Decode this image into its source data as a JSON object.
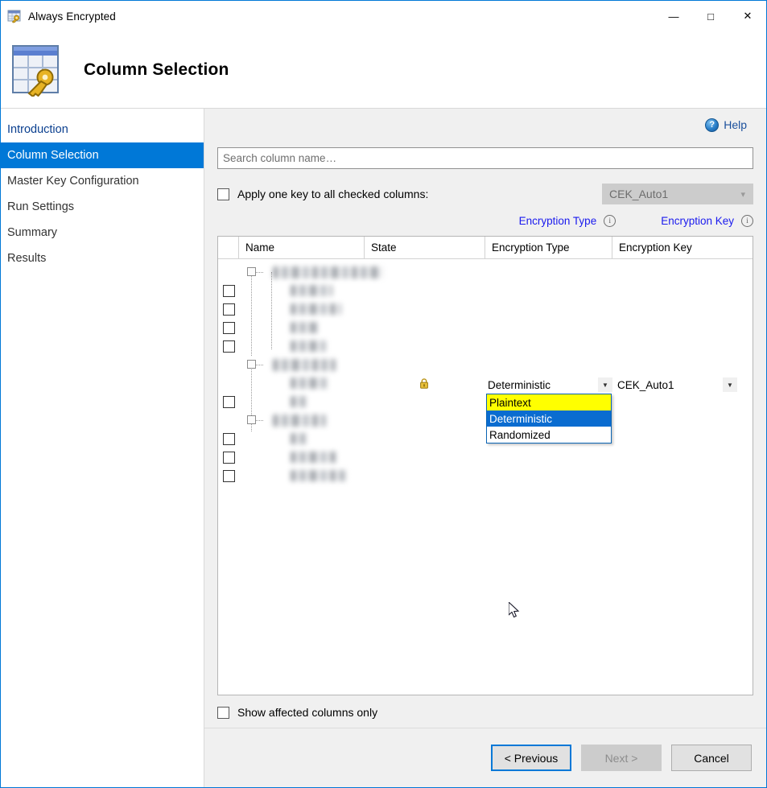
{
  "window": {
    "title": "Always Encrypted",
    "icon": "table-key-icon",
    "controls": {
      "minimize": "—",
      "maximize": "□",
      "close": "✕"
    }
  },
  "header": {
    "title": "Column Selection",
    "icon": "table-key-large-icon"
  },
  "sidebar": {
    "items": [
      {
        "label": "Introduction",
        "state": "link"
      },
      {
        "label": "Column Selection",
        "state": "active"
      },
      {
        "label": "Master Key Configuration",
        "state": "normal"
      },
      {
        "label": "Run Settings",
        "state": "normal"
      },
      {
        "label": "Summary",
        "state": "normal"
      },
      {
        "label": "Results",
        "state": "normal"
      }
    ]
  },
  "main": {
    "help_label": "Help",
    "search": {
      "placeholder": "Search column name…",
      "value": ""
    },
    "apply_key": {
      "label": "Apply one key to all checked columns:",
      "checked": false,
      "key_value": "CEK_Auto1",
      "key_enabled": false
    },
    "hints": {
      "encryption_type": "Encryption Type",
      "encryption_key": "Encryption Key",
      "info_glyph": "i"
    },
    "grid": {
      "columns": [
        "",
        "Name",
        "State",
        "Encryption Type",
        "Encryption Key"
      ],
      "rows": [
        {
          "type": "group",
          "indent": 0,
          "checkbox": false,
          "expanded": true,
          "name_redacted": true,
          "name_width": 136
        },
        {
          "type": "column",
          "indent": 1,
          "checkbox": true,
          "name_redacted": true,
          "name_width": 52
        },
        {
          "type": "column",
          "indent": 1,
          "checkbox": true,
          "name_redacted": true,
          "name_width": 63
        },
        {
          "type": "column",
          "indent": 1,
          "checkbox": true,
          "name_redacted": true,
          "name_width": 36
        },
        {
          "type": "column",
          "indent": 1,
          "checkbox": true,
          "name_redacted": true,
          "name_width": 44
        },
        {
          "type": "group",
          "indent": 0,
          "checkbox": false,
          "expanded": true,
          "name_redacted": true,
          "name_width": 78
        },
        {
          "type": "column",
          "indent": 1,
          "checkbox": false,
          "name_redacted": true,
          "name_width": 47,
          "state_icon": "lock-icon",
          "encryption_type": "Deterministic",
          "encryption_key": "CEK_Auto1",
          "active": true
        },
        {
          "type": "column",
          "indent": 1,
          "checkbox": true,
          "name_redacted": true,
          "name_width": 20
        },
        {
          "type": "group",
          "indent": 0,
          "checkbox": false,
          "expanded": true,
          "name_redacted": true,
          "name_width": 66
        },
        {
          "type": "column",
          "indent": 1,
          "checkbox": true,
          "name_redacted": true,
          "name_width": 20
        },
        {
          "type": "column",
          "indent": 1,
          "checkbox": true,
          "name_redacted": true,
          "name_width": 58
        },
        {
          "type": "column",
          "indent": 1,
          "checkbox": true,
          "name_redacted": true,
          "name_width": 72
        }
      ]
    },
    "encryption_type_dropdown": {
      "open": true,
      "current": "Deterministic",
      "options": [
        {
          "label": "Plaintext",
          "state": "hover"
        },
        {
          "label": "Deterministic",
          "state": "selected"
        },
        {
          "label": "Randomized",
          "state": "normal"
        }
      ]
    },
    "encryption_key_combo": {
      "value": "CEK_Auto1"
    },
    "show_affected": {
      "label": "Show affected columns only",
      "checked": false
    }
  },
  "footer": {
    "previous": "< Previous",
    "next": "Next >",
    "cancel": "Cancel"
  },
  "colors": {
    "accent": "#0078d7",
    "link": "#1a1aee",
    "highlight_yellow": "#ffff00",
    "select_blue": "#0a6cd0",
    "panel_bg": "#f0f0f0"
  }
}
